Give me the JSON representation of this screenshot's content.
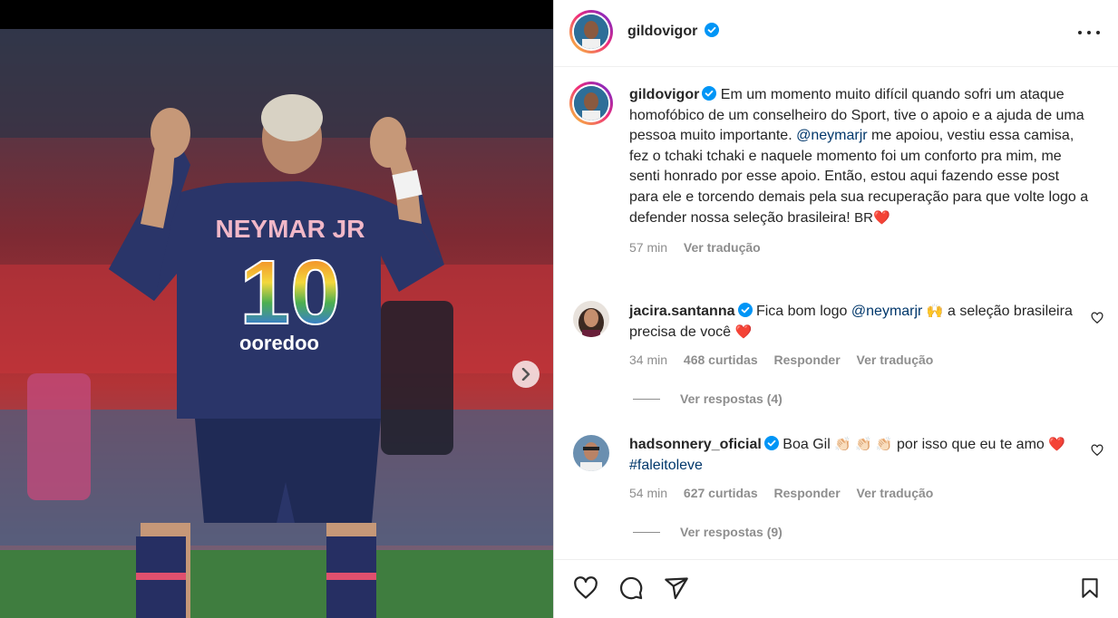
{
  "post": {
    "username": "gildovigor",
    "caption": "Em um momento muito difícil quando sofri um ataque homofóbico de um conselheiro do Sport, tive o apoio e a ajuda de uma pessoa muito importante.",
    "mention": "@neymarjr",
    "caption_rest": "me apoiou, vestiu essa camisa, fez o tchaki tchaki e naquele momento foi um conforto pra mim, me senti honrado por esse apoio. Então, estou aqui fazendo esse post para ele e torcendo demais pela sua recuperação para que volte logo a defender nossa seleção brasileira!",
    "caption_emoji": "BR❤️",
    "time": "57 min",
    "see_translation": "Ver tradução"
  },
  "jersey": {
    "name": "NEYMAR JR",
    "number": "10",
    "sponsor": "ooredoo"
  },
  "comments": [
    {
      "username": "jacira.santanna",
      "text_before": "Fica bom logo",
      "mention": "@neymarjr",
      "emoji": "🙌",
      "text_after": "a seleção brasileira precisa de você",
      "end_emoji": "❤️",
      "time": "34 min",
      "likes": "468 curtidas",
      "reply": "Responder",
      "translate": "Ver tradução",
      "view_replies": "Ver respostas (4)"
    },
    {
      "username": "hadsonnery_oficial",
      "text_before": "Boa Gil",
      "emoji": "👏🏻 👏🏻 👏🏻",
      "text_after": "por isso que eu te amo",
      "end_emoji": "❤️",
      "hashtag": "#faleitoleve",
      "time": "54 min",
      "likes": "627 curtidas",
      "reply": "Responder",
      "translate": "Ver tradução",
      "view_replies": "Ver respostas (9)"
    }
  ],
  "colors": {
    "text": "#262626",
    "secondary": "#8e8e8e",
    "link": "#00376b",
    "verified": "#0095f6",
    "heart": "#ed4956"
  },
  "icons": [
    "verified-badge-icon",
    "more-options-icon",
    "next-arrow-icon",
    "heart-icon",
    "comment-icon",
    "share-icon",
    "bookmark-icon"
  ]
}
